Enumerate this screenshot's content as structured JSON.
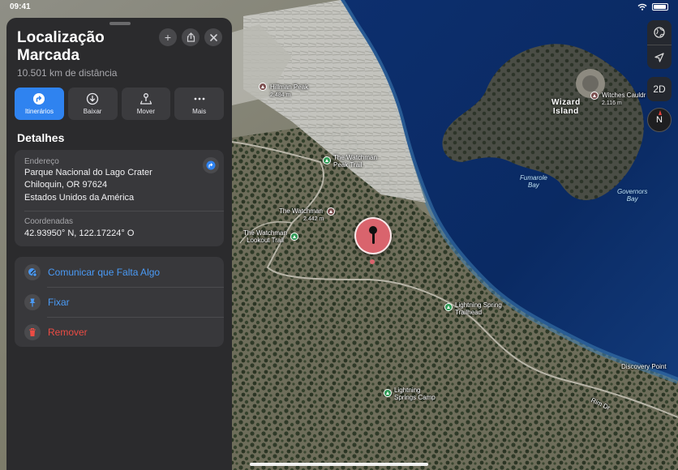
{
  "status_bar": {
    "time": "09:41",
    "icons": [
      "wifi-icon",
      "battery-icon"
    ]
  },
  "sheet": {
    "title": "Localização Marcada",
    "subtitle": "10.501 km de distância",
    "header_buttons": [
      "plus-icon",
      "share-icon",
      "close-icon"
    ],
    "actions": [
      {
        "label": "Itinerários",
        "icon": "directions-icon",
        "selected": true
      },
      {
        "label": "Baixar",
        "icon": "download-icon",
        "selected": false
      },
      {
        "label": "Mover",
        "icon": "move-pin-icon",
        "selected": false
      },
      {
        "label": "Mais",
        "icon": "more-icon",
        "selected": false
      }
    ],
    "details": {
      "heading": "Detalhes",
      "address_label": "Endereço",
      "address_lines": [
        "Parque Nacional do Lago Crater",
        "Chiloquin, OR  97624",
        "Estados Unidos da América"
      ],
      "coordinates_label": "Coordenadas",
      "coordinates_value": "42.93950° N, 122.17224° O"
    },
    "options": [
      {
        "label": "Comunicar que Falta Algo",
        "icon": "report-icon",
        "color": "#4a9af5"
      },
      {
        "label": "Fixar",
        "icon": "pin-icon",
        "color": "#4a9af5"
      },
      {
        "label": "Remover",
        "icon": "trash-icon",
        "color": "#ec4c44"
      }
    ]
  },
  "map": {
    "controls": {
      "layers_icon": "globe-icon",
      "location_icon": "location-arrow-icon",
      "view_mode": "2D",
      "compass": "N"
    },
    "labels": {
      "hillman_peak": "Hillman Peak",
      "hillman_peak_elev": "2.484 m",
      "watchman_peak_trail": "The Watchman\nPeak Trail",
      "the_watchman": "The Watchman",
      "the_watchman_elev": "2.442 m",
      "watchman_lookout_trail": "The Watchman\nLookout Trail",
      "wizard_island": "Wizard\nIsland",
      "witches_cauldron": "Witches Cauldr",
      "witches_cauldron_elev": "2.116 m",
      "fumarole_bay": "Fumarole\nBay",
      "governors_bay": "Governors\nBay",
      "lightning_spring_trailhead": "Lightning Spring\nTrailhead",
      "lightning_springs_camp": "Lightning\nSprings Camp",
      "discovery_point": "Discovery Point",
      "rim_dr": "Rim Dr"
    }
  }
}
